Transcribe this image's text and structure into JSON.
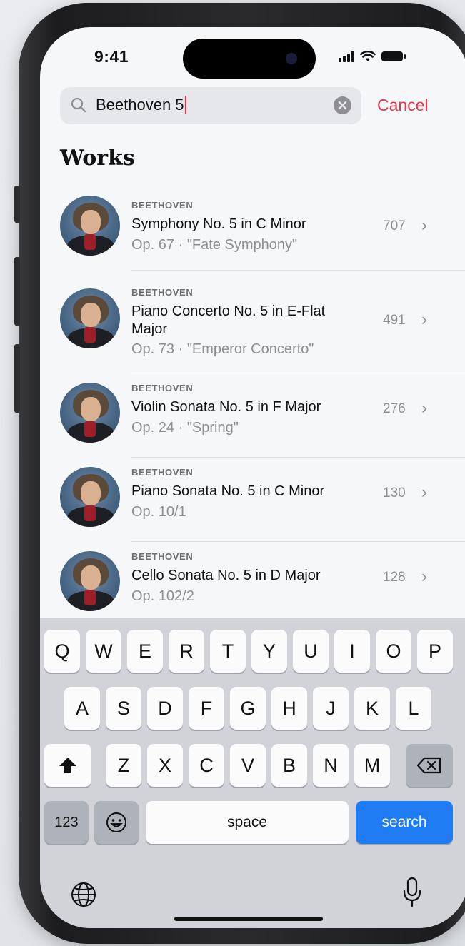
{
  "status_bar": {
    "time": "9:41"
  },
  "search": {
    "query": "Beethoven 5",
    "cancel_label": "Cancel"
  },
  "section_title": "Works",
  "works": [
    {
      "composer": "BEETHOVEN",
      "title": "Symphony No. 5 in C Minor",
      "subtitle": "Op. 67 · \"Fate Symphony\"",
      "count": "707"
    },
    {
      "composer": "BEETHOVEN",
      "title": "Piano Concerto No. 5 in E-Flat Major",
      "subtitle": "Op. 73 · \"Emperor Concerto\"",
      "count": "491"
    },
    {
      "composer": "BEETHOVEN",
      "title": "Violin Sonata No. 5 in F Major",
      "subtitle": "Op. 24 · \"Spring\"",
      "count": "276"
    },
    {
      "composer": "BEETHOVEN",
      "title": "Piano Sonata No. 5 in C Minor",
      "subtitle": "Op. 10/1",
      "count": "130"
    },
    {
      "composer": "BEETHOVEN",
      "title": "Cello Sonata No. 5 in D Major",
      "subtitle": "Op. 102/2",
      "count": "128"
    }
  ],
  "keyboard": {
    "row1": [
      "Q",
      "W",
      "E",
      "R",
      "T",
      "Y",
      "U",
      "I",
      "O",
      "P"
    ],
    "row2": [
      "A",
      "S",
      "D",
      "F",
      "G",
      "H",
      "J",
      "K",
      "L"
    ],
    "row3": [
      "Z",
      "X",
      "C",
      "V",
      "B",
      "N",
      "M"
    ],
    "numbers_label": "123",
    "space_label": "space",
    "search_label": "search",
    "icons": {
      "shift": "shift-icon",
      "delete": "backspace-icon",
      "emoji": "emoji-icon",
      "globe": "globe-icon",
      "mic": "microphone-icon"
    }
  },
  "colors": {
    "accent": "#e8344a",
    "search_key": "#1f7cf2",
    "screen_bg": "#f6f7f8",
    "keyboard_bg": "#d1d3d9"
  }
}
